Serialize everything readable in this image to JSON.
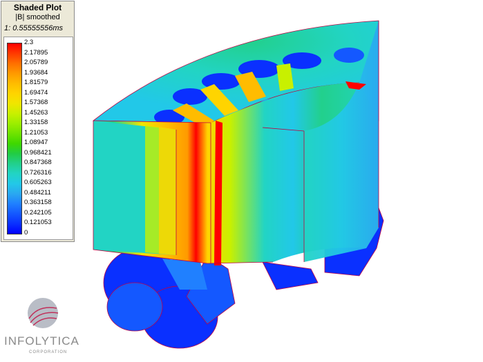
{
  "legend": {
    "title": "Shaded Plot",
    "subtitle": "|B| smoothed",
    "time": "1: 0.55555556ms",
    "ticks": [
      "2.3",
      "2.17895",
      "2.05789",
      "1.93684",
      "1.81579",
      "1.69474",
      "1.57368",
      "1.45263",
      "1.33158",
      "1.21053",
      "1.08947",
      "0.968421",
      "0.847368",
      "0.726316",
      "0.605263",
      "0.484211",
      "0.363158",
      "0.242105",
      "0.121053",
      "0"
    ],
    "colors": [
      "#ff0000",
      "#ff3a00",
      "#ff7000",
      "#ff9a00",
      "#ffbc00",
      "#ffd400",
      "#f0e600",
      "#c8f000",
      "#9cee00",
      "#6fe300",
      "#3ed800",
      "#22cc44",
      "#22d08c",
      "#22d4c4",
      "#22c8e8",
      "#2aa8f0",
      "#2080ff",
      "#1458ff",
      "#0a30ff",
      "#0000ff"
    ]
  },
  "logo": {
    "name": "INFOLYTICA",
    "tagline": "CORPORATION"
  }
}
